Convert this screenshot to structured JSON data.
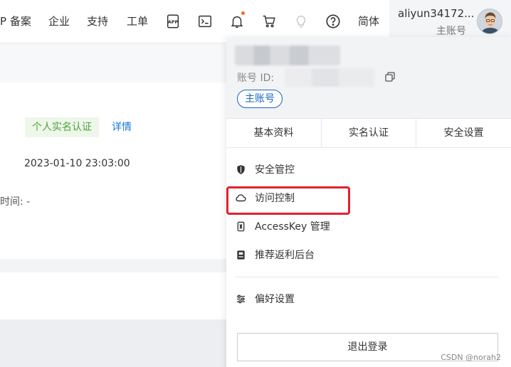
{
  "topnav": {
    "items": [
      {
        "label": "P 备案"
      },
      {
        "label": "企业"
      },
      {
        "label": "支持"
      },
      {
        "label": "工单"
      }
    ],
    "icons": [
      "app-icon",
      "terminal-icon",
      "bell-icon",
      "cart-icon",
      "bulb-icon",
      "help-icon"
    ],
    "lang_label": "简体",
    "notify_dot_color": "#ff6a00"
  },
  "user": {
    "name": "aliyun34172...",
    "role": "主账号"
  },
  "page": {
    "verified_badge": "个人实名认证",
    "detail_link": "详情",
    "date": "2023-01-10 23:03:00",
    "time_label": "时间: -"
  },
  "dropdown": {
    "account_id_label": "账号 ID:",
    "account_badge": "主账号",
    "tabs": [
      {
        "label": "基本资料"
      },
      {
        "label": "实名认证"
      },
      {
        "label": "安全设置"
      }
    ],
    "menu": [
      {
        "label": "安全管控",
        "icon": "shield-icon"
      },
      {
        "label": "访问控制",
        "icon": "cloud-icon"
      },
      {
        "label": "AccessKey 管理",
        "icon": "key-icon"
      },
      {
        "label": "推荐返利后台",
        "icon": "badge-icon"
      },
      {
        "label": "偏好设置",
        "icon": "sliders-icon"
      }
    ],
    "logout_label": "退出登录",
    "highlight_color": "#e0222e"
  },
  "watermark": "CSDN @norah2"
}
